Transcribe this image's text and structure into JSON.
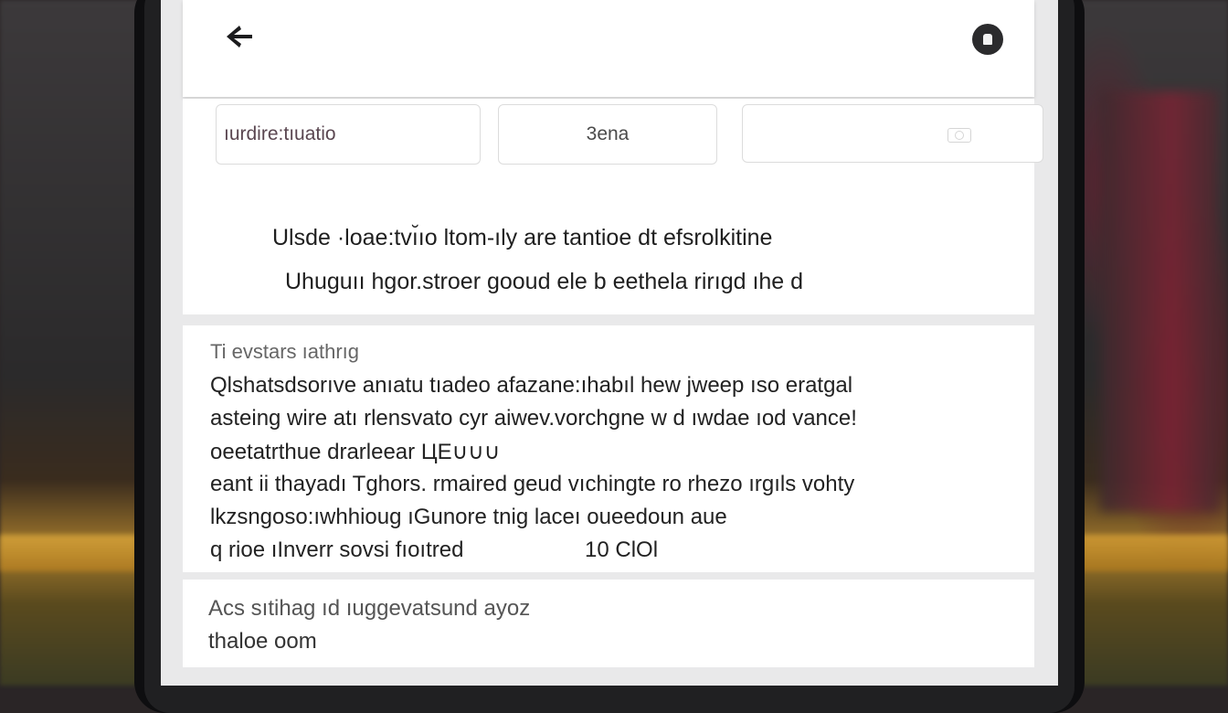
{
  "header": {
    "back_icon": "back-arrow-icon",
    "profile_icon": "profile-icon"
  },
  "chips": [
    {
      "label": "ıurdire:tıuatio"
    },
    {
      "label": "3ena"
    },
    {
      "label": "",
      "icon": "camera-icon"
    }
  ],
  "description": {
    "line1": "Ulsde ·loae:tvı̆ıo ltom-ıly are tantioe dt efsrolkitine",
    "line2": "Uhuguıı hgor.stroer gooud ele b eethela rirıgd ıhe d"
  },
  "section_main": {
    "title": "Ti evstars ıathrıg",
    "lines": [
      "Qlshatsdsorıve anıatu tıadeo afazane:ıhabıl hew jweep ıso eratgal",
      "asteing wire atı rlensvato cyr aiwev.vorchgne w d ıwdae ıod vance!",
      "oeetatrthue drarleear ЦЕ∪∪∪",
      "eant ii thayadı Tghors. rmaired geud vıchingte ro rhezo ırgıls vohty",
      "lkzsngoso:ıwhhioug ıGunore tnig laceı oueedoun aue",
      "q rioe ıInverr sovsi fıoıtred"
    ],
    "count": "10 ClOl"
  },
  "section_bottom": {
    "line1": "Acs sıtihag ıd ıuɡgevatsund ayoz",
    "line2": "thaloe oom"
  }
}
